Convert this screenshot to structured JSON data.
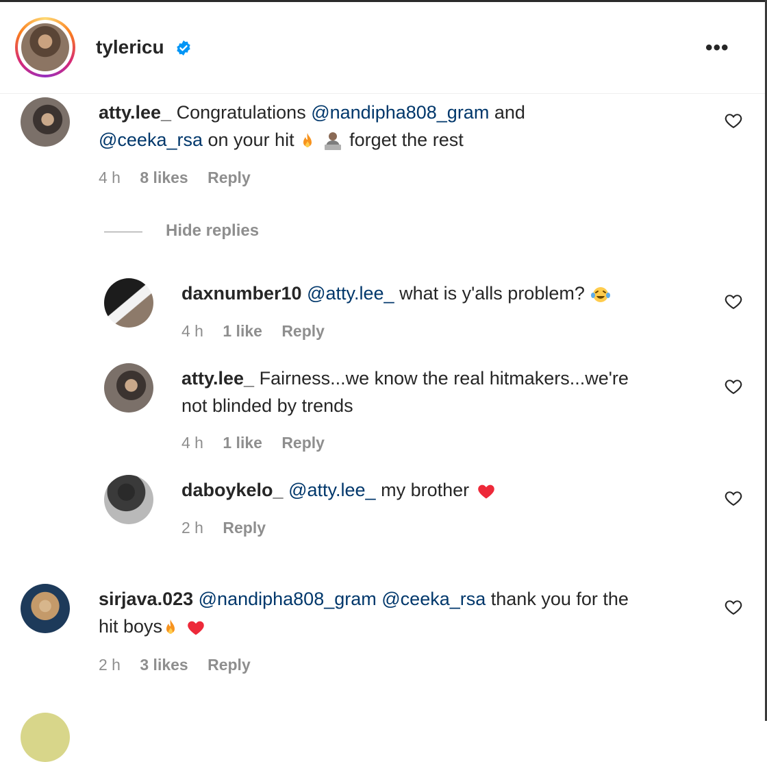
{
  "post_header": {
    "username": "tylericu",
    "more_icon": "more-horizontal-icon",
    "verified_icon": "verified-badge-icon"
  },
  "comments": [
    {
      "username": "atty.lee_",
      "line1_text": "Congratulations",
      "mention1": "@nandipha808_gram",
      "line1_tail": "and",
      "mention2": "@ceeka_rsa",
      "line2_text": "on your hit",
      "line2_tail": "forget the rest",
      "time": "4 h",
      "likes": "8 likes",
      "reply": "Reply"
    },
    {
      "username": "sirjava.023",
      "mention1": "@nandipha808_gram",
      "mention2": "@ceeka_rsa",
      "line1_tail": "thank you for the",
      "line2_text": "hit boys",
      "time": "2 h",
      "likes": "3 likes",
      "reply": "Reply"
    }
  ],
  "hide_replies": "Hide replies",
  "replies": [
    {
      "username": "daxnumber10",
      "mention": "@atty.lee_",
      "text": "what is y'alls problem?",
      "time": "4 h",
      "likes": "1 like",
      "reply": "Reply"
    },
    {
      "username": "atty.lee_",
      "text_line1": "Fairness...we know the real hitmakers...we're",
      "text_line2": "not blinded by trends",
      "time": "4 h",
      "likes": "1 like",
      "reply": "Reply"
    },
    {
      "username": "daboykelo_",
      "mention": "@atty.lee_",
      "text": "my brother",
      "time": "2 h",
      "reply": "Reply"
    }
  ],
  "colors": {
    "mention": "#00376b",
    "meta": "#8e8e8e",
    "verified": "#0095f6",
    "heart_emoji": "#ed2939"
  }
}
